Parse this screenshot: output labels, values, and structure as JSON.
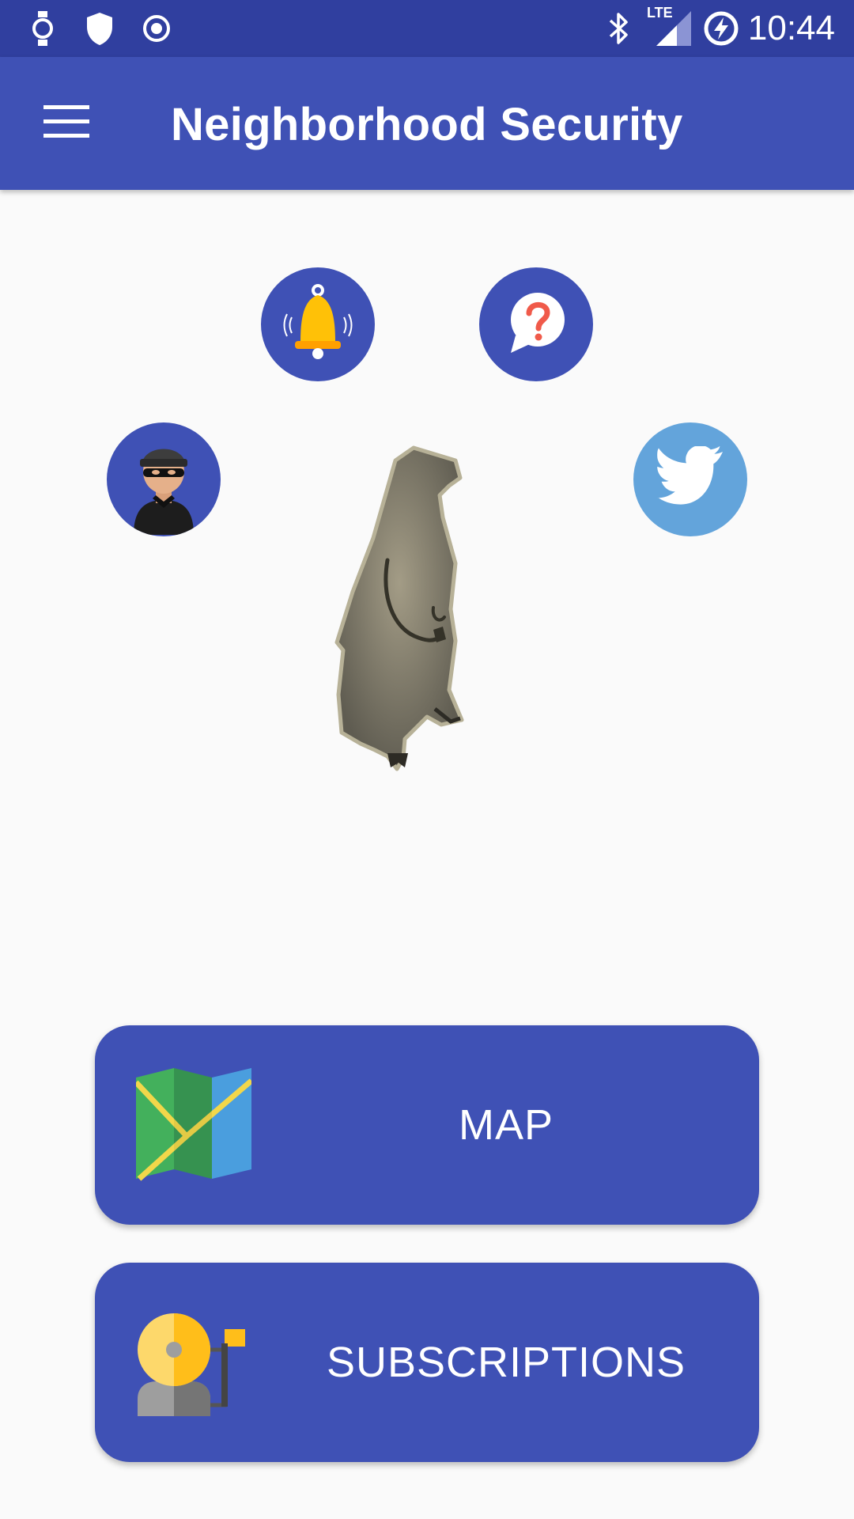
{
  "status_bar": {
    "time": "10:44",
    "network": "LTE",
    "left_icons": [
      "watch-icon",
      "shield-icon",
      "target-icon"
    ],
    "right_icons": [
      "bluetooth-icon",
      "signal-icon",
      "battery-charging-icon"
    ]
  },
  "app_bar": {
    "title": "Neighborhood Security",
    "menu_icon": "hamburger-menu-icon"
  },
  "quick_actions": [
    {
      "name": "alert-bell-button",
      "icon": "bell-icon"
    },
    {
      "name": "help-button",
      "icon": "question-bubble-icon"
    },
    {
      "name": "burglar-button",
      "icon": "burglar-icon"
    },
    {
      "name": "twitter-button",
      "icon": "twitter-bird-icon"
    }
  ],
  "mascot": {
    "icon": "groundhog-silhouette-icon"
  },
  "buttons": {
    "map_label": "MAP",
    "map_icon": "folded-map-icon",
    "subscriptions_label": "SUBSCRIPTIONS",
    "subscriptions_icon": "alarm-bell-icon"
  },
  "colors": {
    "status_bar": "#303f9f",
    "primary": "#3f51b5",
    "twitter": "#63a4db",
    "background": "#fafafa"
  }
}
